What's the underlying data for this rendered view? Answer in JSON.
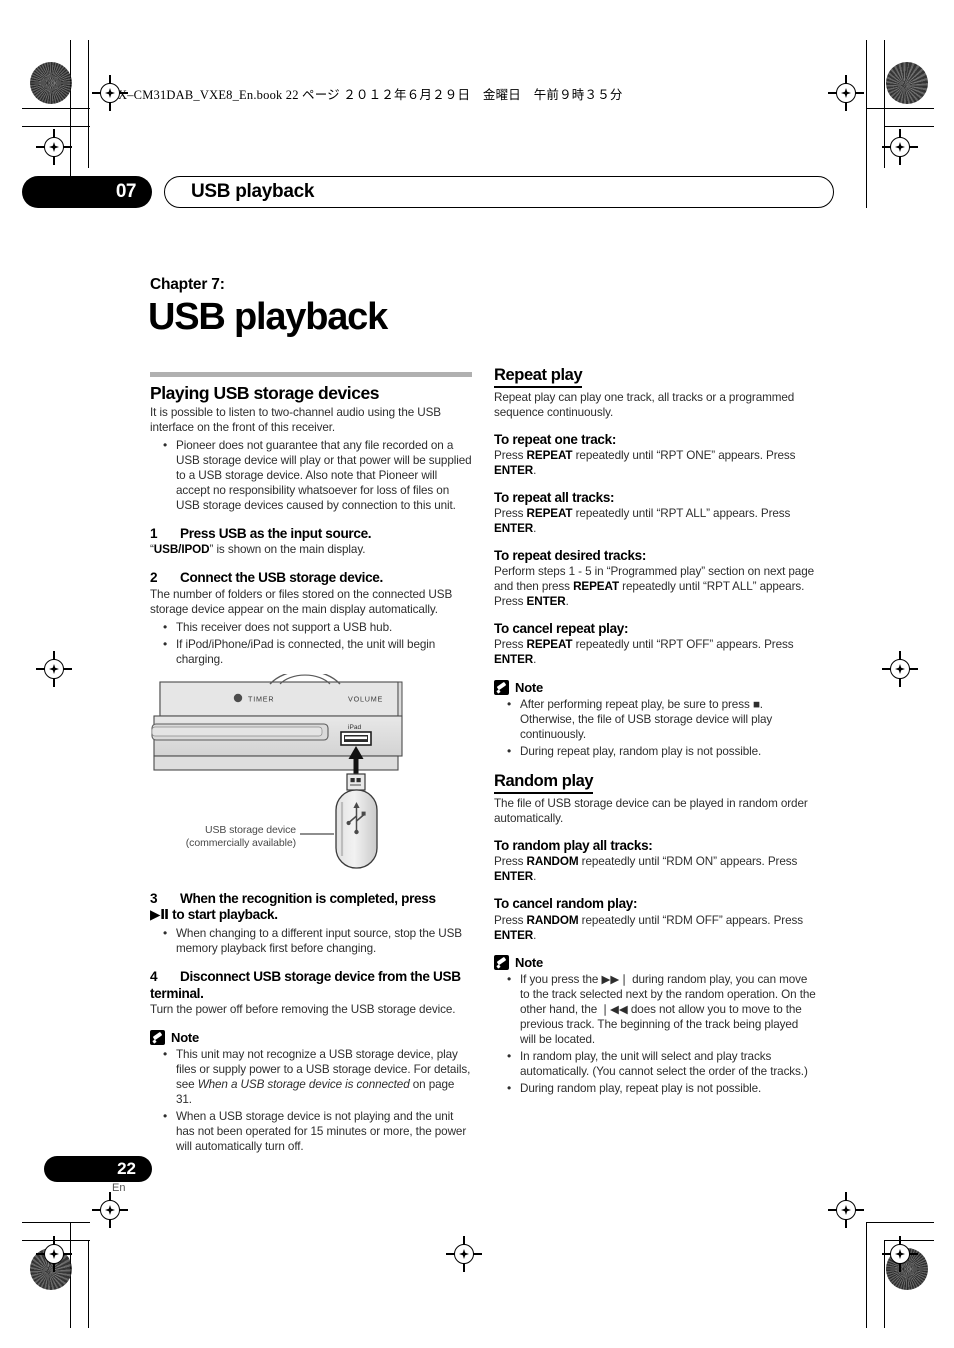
{
  "print_info": {
    "file_line": "X–CM31DAB_VXE8_En.book   22 ページ   ２０１２年６月２９日　金曜日　午前９時３５分"
  },
  "running_head": {
    "chapter_number": "07",
    "title": "USB playback"
  },
  "chapter": {
    "label": "Chapter 7:",
    "title": "USB playback"
  },
  "left_column": {
    "section_title": "Playing USB storage devices",
    "intro": "It is possible to listen to two-channel audio using the USB interface on the front of this receiver.",
    "intro_bullets": [
      "Pioneer does not guarantee that any file recorded on a USB storage device will play or that power will be supplied to a USB storage device. Also note that Pioneer will accept no responsibility whatsoever for loss of files on USB storage devices caused by connection to this unit."
    ],
    "steps": [
      {
        "number": "1",
        "heading": "Press USB as the input source.",
        "body_prefix": "“",
        "body_bold": "USB/IPOD",
        "body_suffix": "” is shown on the main display.",
        "bullets": []
      },
      {
        "number": "2",
        "heading": "Connect the USB storage device.",
        "body": "The number of folders or files stored on the connected USB storage device appear on the main display automatically.",
        "bullets": [
          "This receiver does not support a USB hub.",
          "If iPod/iPhone/iPad is connected, the unit will begin charging."
        ]
      },
      {
        "number": "3",
        "heading_part1": "When the recognition is completed, press",
        "heading_glyph": "▶Ⅱ",
        "heading_part2": "to start playback.",
        "bullets": [
          "When changing to a different input source, stop the USB memory playback first before changing."
        ]
      },
      {
        "number": "4",
        "heading": "Disconnect USB storage device from the USB terminal.",
        "body": "Turn the power off before removing the USB storage device.",
        "bullets": []
      }
    ],
    "note": {
      "label": "Note",
      "items": [
        {
          "text_before": "This unit may not recognize a USB storage device, play files or supply power to a USB storage device. For details, see ",
          "italic": "When a USB storage device is connected",
          "text_after": " on page 31."
        },
        {
          "text_before": "When a USB storage device is not playing and the unit has not been operated for 15 minutes or more, the power will automatically turn off.",
          "italic": "",
          "text_after": ""
        }
      ]
    },
    "figure": {
      "label_timer": "TIMER",
      "label_volume": "VOLUME",
      "label_ipad": "iPad",
      "caption_line1": "USB storage device",
      "caption_line2": "(commercially available)"
    }
  },
  "right_column": {
    "repeat": {
      "title": "Repeat play",
      "intro": "Repeat play can play one track, all tracks or a programmed sequence continuously.",
      "subsections": [
        {
          "heading": "To repeat one track:",
          "parts": [
            "Press ",
            "REPEAT",
            " repeatedly until “RPT ONE” appears. Press ",
            "ENTER",
            "."
          ]
        },
        {
          "heading": "To repeat all tracks:",
          "parts": [
            "Press ",
            "REPEAT",
            " repeatedly until “RPT ALL” appears. Press ",
            "ENTER",
            "."
          ]
        },
        {
          "heading": "To repeat desired tracks:",
          "parts": [
            "Perform steps 1 - 5 in “Programmed play” section on next page and then press ",
            "REPEAT",
            " repeatedly until “RPT ALL” appears. Press ",
            "ENTER",
            "."
          ]
        },
        {
          "heading": "To cancel repeat play:",
          "parts": [
            "Press ",
            "REPEAT",
            " repeatedly until “RPT OFF” appears. Press ",
            "ENTER",
            "."
          ]
        }
      ],
      "note": {
        "label": "Note",
        "items": [
          "After performing repeat play, be sure to press ■. Otherwise, the file of USB storage device will play continuously.",
          "During repeat play, random play is not possible."
        ]
      }
    },
    "random": {
      "title": "Random play",
      "intro": "The file of USB storage device can be played in random order automatically.",
      "subsections": [
        {
          "heading": "To random play all tracks:",
          "parts": [
            "Press ",
            "RANDOM",
            " repeatedly until “RDM ON” appears. Press ",
            "ENTER",
            "."
          ]
        },
        {
          "heading": "To cancel random play:",
          "parts": [
            "Press ",
            "RANDOM",
            " repeatedly until “RDM OFF” appears. Press ",
            "ENTER",
            "."
          ]
        }
      ],
      "note": {
        "label": "Note",
        "items": [
          "If you press the ▶▶❘ during random play, you can move to the track selected next by the random operation. On the other hand, the ❘◀◀ does not allow you to move to the previous track. The beginning of the track being played will be located.",
          "In random play, the unit will select and play tracks automatically. (You cannot select the order of the tracks.)",
          "During random play, repeat play is not possible."
        ]
      }
    }
  },
  "footer": {
    "page_number": "22",
    "language": "En"
  }
}
